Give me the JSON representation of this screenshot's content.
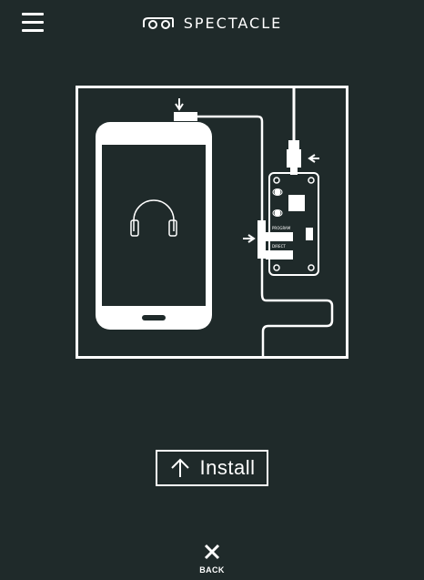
{
  "header": {
    "menu_icon": "hamburger-menu-icon",
    "brand_name": "SPECTACLE",
    "brand_logo_icon": "spectacles-logo-icon"
  },
  "illustration": {
    "board_labels": {
      "program": "PROGRAM",
      "direct": "DIRECT"
    },
    "phone_icon": "headphones-icon"
  },
  "actions": {
    "install_label": "Install",
    "install_icon": "arrow-up-icon",
    "back_label": "BACK",
    "back_icon": "close-icon"
  },
  "colors": {
    "background": "#1f2a2a",
    "foreground": "#ffffff"
  }
}
